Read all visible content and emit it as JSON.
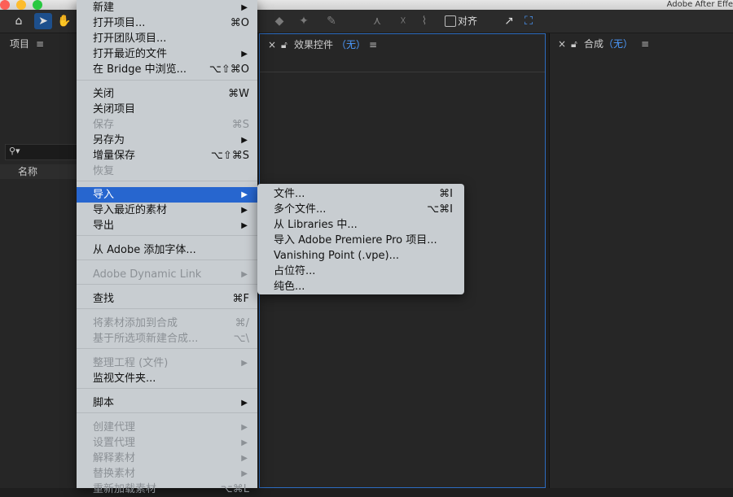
{
  "app_title": "Adobe After Effe",
  "toolbar": {
    "align_label": "对齐",
    "tools": [
      "home-icon",
      "selection-tool-icon",
      "hand-tool-icon",
      "eraser-tool-icon",
      "pin-tool-icon",
      "puppet-tool-icon"
    ]
  },
  "panels": {
    "project": {
      "title": "项目",
      "menu": "≡",
      "column_name": "名称",
      "search_icon": "⚲▾"
    },
    "effects": {
      "close": "×",
      "title": "效果控件",
      "value": "（无）",
      "menu": "≡"
    },
    "composition": {
      "close": "×",
      "title": "合成",
      "value": "（无）",
      "menu": "≡"
    }
  },
  "file_menu": {
    "items": [
      {
        "label": "新建",
        "shortcut": "",
        "arrow": "▶",
        "disabled": false
      },
      {
        "label": "打开项目...",
        "shortcut": "⌘O",
        "arrow": "",
        "disabled": false
      },
      {
        "label": "打开团队项目...",
        "shortcut": "",
        "arrow": "",
        "disabled": false
      },
      {
        "label": "打开最近的文件",
        "shortcut": "",
        "arrow": "▶",
        "disabled": false
      },
      {
        "label": "在 Bridge 中浏览...",
        "shortcut": "⌥⇧⌘O",
        "arrow": "",
        "disabled": false
      },
      {
        "label": "关闭",
        "shortcut": "⌘W",
        "arrow": "",
        "disabled": false
      },
      {
        "label": "关闭项目",
        "shortcut": "",
        "arrow": "",
        "disabled": false
      },
      {
        "label": "保存",
        "shortcut": "⌘S",
        "arrow": "",
        "disabled": true
      },
      {
        "label": "另存为",
        "shortcut": "",
        "arrow": "▶",
        "disabled": false
      },
      {
        "label": "增量保存",
        "shortcut": "⌥⇧⌘S",
        "arrow": "",
        "disabled": false
      },
      {
        "label": "恢复",
        "shortcut": "",
        "arrow": "",
        "disabled": true
      },
      {
        "label": "导入",
        "shortcut": "",
        "arrow": "▶",
        "disabled": false,
        "active": true
      },
      {
        "label": "导入最近的素材",
        "shortcut": "",
        "arrow": "▶",
        "disabled": false
      },
      {
        "label": "导出",
        "shortcut": "",
        "arrow": "▶",
        "disabled": false
      },
      {
        "label": "从 Adobe 添加字体...",
        "shortcut": "",
        "arrow": "",
        "disabled": false
      },
      {
        "label": "Adobe Dynamic Link",
        "shortcut": "",
        "arrow": "▶",
        "disabled": true
      },
      {
        "label": "查找",
        "shortcut": "⌘F",
        "arrow": "",
        "disabled": false
      },
      {
        "label": "将素材添加到合成",
        "shortcut": "⌘/",
        "arrow": "",
        "disabled": true
      },
      {
        "label": "基于所选项新建合成...",
        "shortcut": "⌥\\",
        "arrow": "",
        "disabled": true
      },
      {
        "label": "整理工程 (文件)",
        "shortcut": "",
        "arrow": "▶",
        "disabled": true
      },
      {
        "label": "监视文件夹...",
        "shortcut": "",
        "arrow": "",
        "disabled": false
      },
      {
        "label": "脚本",
        "shortcut": "",
        "arrow": "▶",
        "disabled": false
      },
      {
        "label": "创建代理",
        "shortcut": "",
        "arrow": "▶",
        "disabled": true
      },
      {
        "label": "设置代理",
        "shortcut": "",
        "arrow": "▶",
        "disabled": true
      },
      {
        "label": "解释素材",
        "shortcut": "",
        "arrow": "▶",
        "disabled": true
      },
      {
        "label": "替换素材",
        "shortcut": "",
        "arrow": "▶",
        "disabled": true
      },
      {
        "label": "重新加载素材",
        "shortcut": "⌥⌘L",
        "arrow": "",
        "disabled": true
      }
    ]
  },
  "import_submenu": {
    "items": [
      {
        "label": "文件...",
        "shortcut": "⌘I"
      },
      {
        "label": "多个文件...",
        "shortcut": "⌥⌘I"
      },
      {
        "label": "从 Libraries 中...",
        "shortcut": ""
      },
      {
        "label": "导入 Adobe Premiere Pro 项目...",
        "shortcut": ""
      },
      {
        "label": "Vanishing Point (.vpe)...",
        "shortcut": ""
      },
      {
        "label": "占位符...",
        "shortcut": ""
      },
      {
        "label": "纯色...",
        "shortcut": ""
      }
    ]
  }
}
